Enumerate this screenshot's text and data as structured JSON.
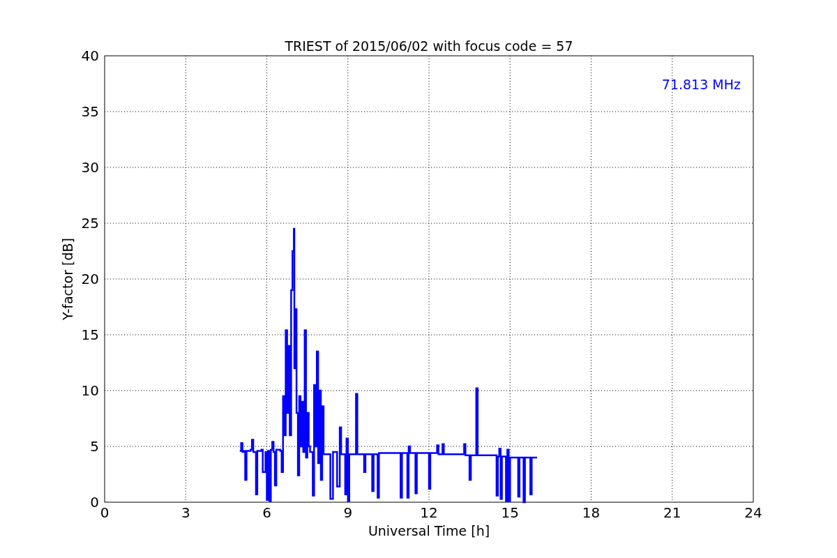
{
  "figure": {
    "chart_data": {
      "type": "line",
      "title": "TRIEST of 2015/06/02 with focus code = 57",
      "xlabel": "Universal Time [h]",
      "ylabel": "Y-factor [dB]",
      "x": [
        5.0,
        5.05,
        5.1,
        5.15,
        5.2,
        5.25,
        5.4,
        5.45,
        5.5,
        5.6,
        5.65,
        5.8,
        5.85,
        5.95,
        6.0,
        6.05,
        6.1,
        6.15,
        6.2,
        6.25,
        6.3,
        6.35,
        6.5,
        6.55,
        6.6,
        6.65,
        6.7,
        6.75,
        6.8,
        6.85,
        6.9,
        6.95,
        7.0,
        7.02,
        7.05,
        7.1,
        7.15,
        7.2,
        7.25,
        7.3,
        7.35,
        7.4,
        7.45,
        7.5,
        7.55,
        7.6,
        7.7,
        7.75,
        7.8,
        7.85,
        7.9,
        7.95,
        8.0,
        8.05,
        8.1,
        8.3,
        8.35,
        8.45,
        8.6,
        8.7,
        8.75,
        8.9,
        8.95,
        9.0,
        9.05,
        9.3,
        9.35,
        9.6,
        9.65,
        9.9,
        9.95,
        10.1,
        10.15,
        10.95,
        11.0,
        11.2,
        11.25,
        11.3,
        11.5,
        11.55,
        12.0,
        12.05,
        12.3,
        12.35,
        12.5,
        12.55,
        13.3,
        13.35,
        13.5,
        13.55,
        13.75,
        13.8,
        14.5,
        14.55,
        14.6,
        14.65,
        14.7,
        14.85,
        14.9,
        14.95,
        15.0,
        15.3,
        15.35,
        15.5,
        15.55,
        15.75,
        15.8,
        16.0
      ],
      "series": [
        {
          "name": "71.813 MHz",
          "color": "#0000ff",
          "values": [
            4.6,
            5.3,
            4.5,
            4.6,
            2.0,
            4.6,
            4.7,
            5.6,
            4.5,
            0.7,
            4.6,
            4.7,
            2.7,
            4.5,
            0.2,
            4.6,
            0.1,
            4.7,
            5.4,
            4.5,
            1.5,
            4.7,
            4.6,
            2.7,
            9.5,
            6.0,
            15.4,
            8.0,
            14.0,
            6.0,
            19.0,
            22.5,
            24.5,
            12.0,
            17.3,
            8.0,
            2.4,
            9.5,
            5.0,
            9.0,
            4.5,
            15.4,
            4.0,
            8.0,
            5.0,
            4.5,
            0.6,
            10.5,
            5.0,
            13.5,
            3.5,
            10.0,
            2.0,
            8.6,
            4.3,
            4.3,
            0.3,
            4.5,
            1.4,
            6.7,
            4.3,
            0.7,
            5.7,
            0.1,
            4.3,
            9.7,
            4.3,
            2.7,
            4.3,
            1.0,
            4.3,
            0.4,
            4.4,
            0.4,
            4.4,
            0.4,
            5.0,
            4.4,
            0.8,
            4.4,
            1.2,
            4.4,
            5.1,
            4.3,
            5.2,
            4.3,
            5.2,
            4.2,
            2.0,
            4.2,
            10.2,
            4.2,
            0.6,
            4.1,
            4.8,
            0.3,
            4.1,
            0.1,
            4.7,
            0.1,
            4.0,
            0.5,
            4.0,
            0.0,
            4.0,
            0.7,
            4.0,
            4.0
          ]
        }
      ],
      "xlim": [
        0,
        24
      ],
      "ylim": [
        0,
        40
      ],
      "xticks": [
        0,
        3,
        6,
        9,
        12,
        15,
        18,
        21,
        24
      ],
      "yticks": [
        0,
        5,
        10,
        15,
        20,
        25,
        30,
        35,
        40
      ],
      "grid": true
    }
  }
}
